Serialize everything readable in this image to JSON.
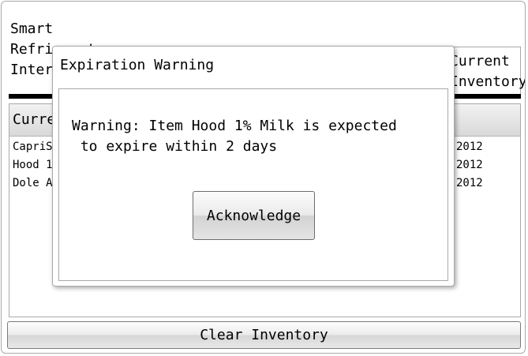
{
  "app": {
    "title": "Smart\nRefrigerator\nInterface"
  },
  "tabs": {
    "current_inventory": "Current\nInventory"
  },
  "panel": {
    "header": "Current Inventory",
    "rows": [
      {
        "name": "CapriSun",
        "date": "2012"
      },
      {
        "name": "Hood 1% Milk",
        "date": "2012"
      },
      {
        "name": "Dole Apple",
        "date": "2012"
      }
    ]
  },
  "footer": {
    "clear_label": "Clear Inventory"
  },
  "dialog": {
    "title": "Expiration Warning",
    "message": "Warning: Item Hood 1% Milk is expected\n to expire within 2 days",
    "button_label": "Acknowledge"
  }
}
